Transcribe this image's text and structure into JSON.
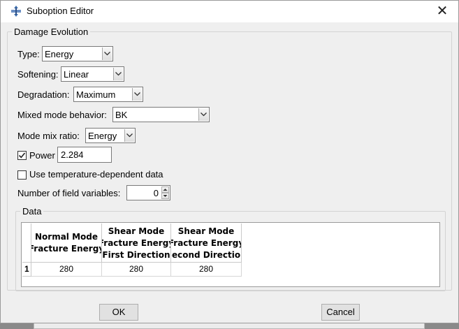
{
  "window": {
    "title": "Suboption Editor"
  },
  "damage_evolution": {
    "legend": "Damage Evolution",
    "type": {
      "label": "Type:",
      "value": "Energy"
    },
    "softening": {
      "label": "Softening:",
      "value": "Linear"
    },
    "degradation": {
      "label": "Degradation:",
      "value": "Maximum"
    },
    "mixed_mode": {
      "label": "Mixed mode behavior:",
      "value": "BK"
    },
    "mode_mix_ratio": {
      "label": "Mode mix ratio:",
      "value": "Energy"
    },
    "power": {
      "label": "Power",
      "checked": true,
      "value": "2.284"
    },
    "temp_dependent": {
      "label": "Use temperature-dependent data",
      "checked": false
    },
    "field_variables": {
      "label": "Number of field variables:",
      "value": "0"
    }
  },
  "data": {
    "legend": "Data",
    "columns": [
      "Normal Mode\nFracture Energy",
      "Shear Mode\nFracture Energy\nFirst Direction",
      "Shear Mode\nFracture Energy\nSecond Direction"
    ],
    "rows": [
      {
        "index": "1",
        "cells": [
          "280",
          "280",
          "280"
        ]
      }
    ]
  },
  "buttons": {
    "ok": "OK",
    "cancel": "Cancel"
  },
  "icons": {
    "app": "abaqus-logo-icon",
    "close": "close-icon",
    "dropdown": "chevron-down-icon",
    "check": "checkmark-icon"
  }
}
